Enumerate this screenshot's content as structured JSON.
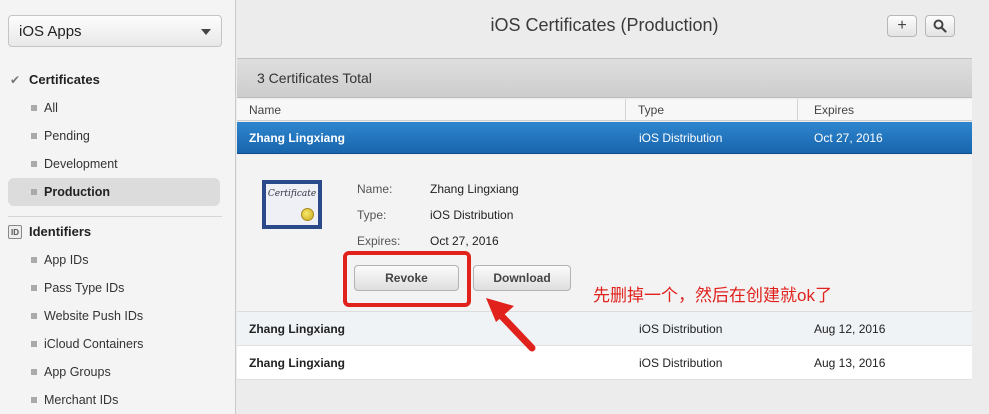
{
  "sidebar": {
    "app_select": {
      "value": "iOS Apps"
    },
    "sections": [
      {
        "title": "Certificates",
        "items": [
          {
            "label": "All"
          },
          {
            "label": "Pending"
          },
          {
            "label": "Development"
          },
          {
            "label": "Production",
            "active": true
          }
        ]
      },
      {
        "title": "Identifiers",
        "items": [
          {
            "label": "App IDs"
          },
          {
            "label": "Pass Type IDs"
          },
          {
            "label": "Website Push IDs"
          },
          {
            "label": "iCloud Containers"
          },
          {
            "label": "App Groups"
          },
          {
            "label": "Merchant IDs"
          }
        ]
      }
    ]
  },
  "header": {
    "title": "iOS Certificates (Production)",
    "add_button": "+",
    "search_icon": "search-icon"
  },
  "summary": {
    "total_text": "3 Certificates Total"
  },
  "table": {
    "columns": [
      "Name",
      "Type",
      "Expires"
    ],
    "rows": [
      {
        "name": "Zhang Lingxiang",
        "type": "iOS Distribution",
        "expires": "Oct 27, 2016",
        "selected": true
      },
      {
        "name": "Zhang Lingxiang",
        "type": "iOS Distribution",
        "expires": "Aug 12, 2016"
      },
      {
        "name": "Zhang Lingxiang",
        "type": "iOS Distribution",
        "expires": "Aug 13, 2016"
      }
    ]
  },
  "detail": {
    "icon_text": "Certificate",
    "fields": [
      {
        "label": "Name:",
        "value": "Zhang Lingxiang"
      },
      {
        "label": "Type:",
        "value": "iOS Distribution"
      },
      {
        "label": "Expires:",
        "value": "Oct 27, 2016"
      }
    ],
    "revoke_button": "Revoke",
    "download_button": "Download"
  },
  "annotation": {
    "text": "先删掉一个，然后在创建就ok了",
    "color": "#e0211c"
  },
  "colors": {
    "selection": "#1f74bd",
    "annotation_red": "#e0211c"
  }
}
